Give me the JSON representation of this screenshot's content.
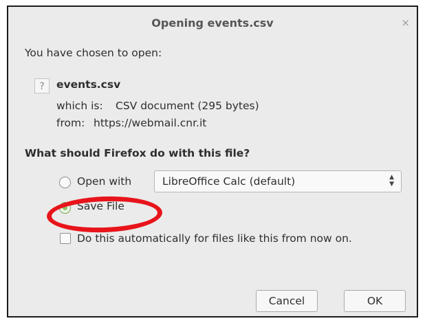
{
  "dialog": {
    "title": "Opening events.csv",
    "close_glyph": "×",
    "intro": "You have chosen to open:",
    "file": {
      "icon": "unknown-file-icon",
      "icon_glyph": "?",
      "name": "events.csv",
      "which_is_label": "which is:",
      "which_is_value": "CSV document (295 bytes)",
      "from_label": "from:",
      "from_value": "https://webmail.cnr.it"
    },
    "question": "What should Firefox do with this file?",
    "options": {
      "open_with": {
        "label": "Open with",
        "selected": false
      },
      "app_select": {
        "value": "LibreOffice Calc (default)"
      },
      "save_file": {
        "label": "Save File",
        "selected": true
      },
      "auto_checkbox": {
        "label": "Do this automatically for files like this from now on.",
        "checked": false
      }
    },
    "buttons": {
      "cancel": "Cancel",
      "ok": "OK"
    },
    "annotation_color": "#e8141b"
  }
}
